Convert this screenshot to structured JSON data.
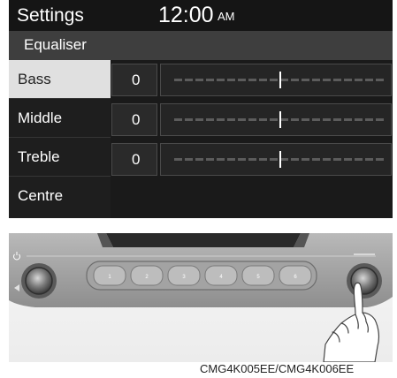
{
  "status_bar": {
    "title": "Settings",
    "time": "12:00",
    "ampm": "AM"
  },
  "section": {
    "title": "Equaliser"
  },
  "sidebar": {
    "items": [
      {
        "label": "Bass",
        "selected": true
      },
      {
        "label": "Middle",
        "selected": false
      },
      {
        "label": "Treble",
        "selected": false
      },
      {
        "label": "Centre",
        "selected": false
      }
    ]
  },
  "equaliser": {
    "rows": [
      {
        "name": "Bass",
        "value": "0",
        "level": 0.5
      },
      {
        "name": "Middle",
        "value": "0",
        "level": 0.5
      },
      {
        "name": "Treble",
        "value": "0",
        "level": 0.5
      }
    ]
  },
  "console": {
    "preset_buttons": [
      "1",
      "2",
      "3",
      "4",
      "5",
      "6"
    ]
  },
  "caption": "CMG4K005EE/CMG4K006EE"
}
